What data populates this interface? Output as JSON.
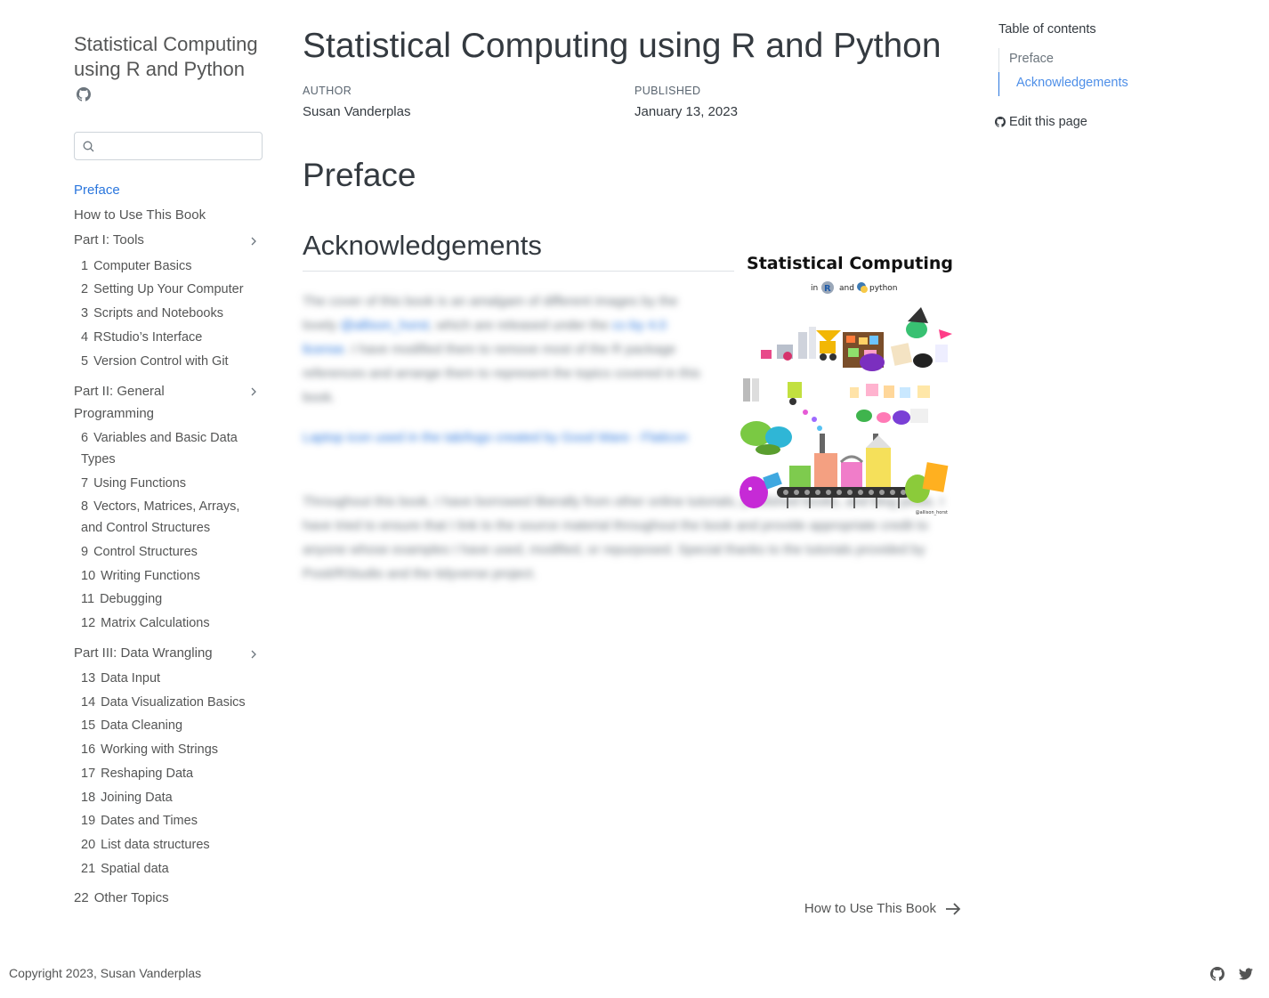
{
  "sidebar": {
    "book_title": "Statistical Computing using R and Python",
    "search_placeholder": "",
    "items": [
      {
        "label": "Preface"
      },
      {
        "label": "How to Use This Book"
      },
      {
        "label": "Part I: Tools"
      },
      {
        "num": "1",
        "label": "Computer Basics"
      },
      {
        "num": "2",
        "label": "Setting Up Your Computer"
      },
      {
        "num": "3",
        "label": "Scripts and Notebooks"
      },
      {
        "num": "4",
        "label": "RStudio’s Interface"
      },
      {
        "num": "5",
        "label": "Version Control with Git"
      },
      {
        "label": "Part II: General Programming"
      },
      {
        "num": "6",
        "label": "Variables and Basic Data Types"
      },
      {
        "num": "7",
        "label": "Using Functions"
      },
      {
        "num": "8",
        "label": "Vectors, Matrices, Arrays, and Control Structures"
      },
      {
        "num": "9",
        "label": "Control Structures"
      },
      {
        "num": "10",
        "label": "Writing Functions"
      },
      {
        "num": "11",
        "label": "Debugging"
      },
      {
        "num": "12",
        "label": "Matrix Calculations"
      },
      {
        "label": "Part III: Data Wrangling"
      },
      {
        "num": "13",
        "label": "Data Input"
      },
      {
        "num": "14",
        "label": "Data Visualization Basics"
      },
      {
        "num": "15",
        "label": "Data Cleaning"
      },
      {
        "num": "16",
        "label": "Working with Strings"
      },
      {
        "num": "17",
        "label": "Reshaping Data"
      },
      {
        "num": "18",
        "label": "Joining Data"
      },
      {
        "num": "19",
        "label": "Dates and Times"
      },
      {
        "num": "20",
        "label": "List data structures"
      },
      {
        "num": "21",
        "label": "Spatial data"
      },
      {
        "num": "22",
        "label": "Other Topics"
      }
    ]
  },
  "main": {
    "title": "Statistical Computing using R and Python",
    "author_heading": "AUTHOR",
    "author": "Susan Vanderplas",
    "published_heading": "PUBLISHED",
    "published": "January 13, 2023",
    "h_preface": "Preface",
    "h_ack": "Acknowledgements",
    "p1_a": "The cover of this book is an amalgam of different images by the lovely ",
    "p1_link1": "@allison_horst",
    "p1_b": ", which are released under the ",
    "p1_link2": "cc-by 4.0 license",
    "p1_c": ". I have modified them to remove most of the R package references and arrange them to represent the topics covered in this book.",
    "p2": "Laptop icon used in the tab/logo created by Good Ware - Flaticon",
    "p3": "Throughout this book, I have borrowed liberally from other online tutorials, published books, and blog posts. I have tried to ensure that I link to the source material throughout the book and provide appropriate credit to anyone whose examples I have used, modified, or repurposed. Special thanks to the tutorials provided by Posit/RStudio and the tidyverse project.",
    "cover": {
      "title": "Statistical Computing",
      "sub_in": "in",
      "sub_and": "and",
      "sub_python": "python",
      "credit": "@allison_horst"
    },
    "next_label": "How to Use This Book"
  },
  "toc": {
    "title": "Table of contents",
    "items": [
      "Preface",
      "Acknowledgements"
    ],
    "edit": "Edit this page"
  },
  "footer": {
    "copyright": "Copyright 2023, Susan Vanderplas"
  },
  "colors": {
    "accent": "#2a76dd",
    "text": "#343a40",
    "muted": "#545555"
  }
}
